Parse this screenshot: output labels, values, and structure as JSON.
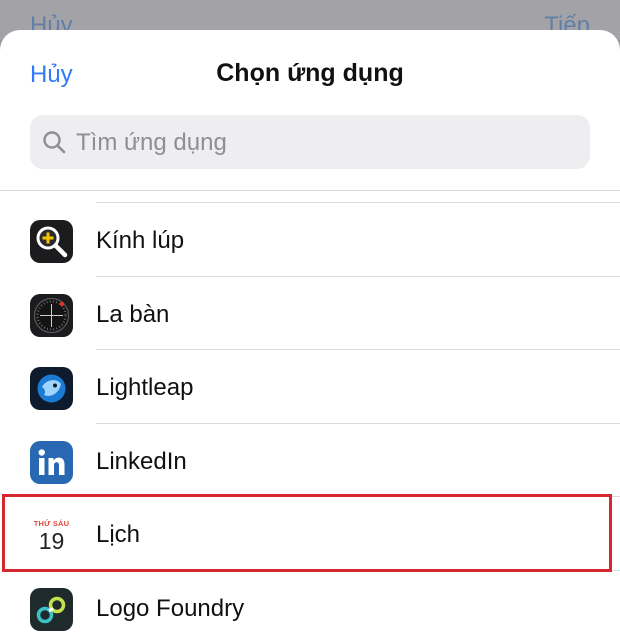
{
  "background": {
    "left_action": "Hủy",
    "right_action": "Tiếp"
  },
  "header": {
    "cancel_label": "Hủy",
    "title": "Chọn ứng dụng"
  },
  "search": {
    "placeholder": "Tìm ứng dụng",
    "icon": "magnifier-icon"
  },
  "apps": [
    {
      "label": "Kính lúp",
      "icon": "magnifier-app-icon"
    },
    {
      "label": "La bàn",
      "icon": "compass-app-icon"
    },
    {
      "label": "Lightleap",
      "icon": "lightleap-app-icon"
    },
    {
      "label": "LinkedIn",
      "icon": "linkedin-app-icon"
    },
    {
      "label": "Lịch",
      "icon": "calendar-app-icon",
      "calendar_day_name": "THỨ SÁU",
      "calendar_date": "19",
      "highlighted": true
    },
    {
      "label": "Logo Foundry",
      "icon": "logo-foundry-app-icon"
    }
  ],
  "colors": {
    "accent": "#2f7cf6",
    "highlight_border": "#d62630",
    "linkedin_blue": "#2867b2",
    "lightleap_blue": "#1b7ad3"
  }
}
